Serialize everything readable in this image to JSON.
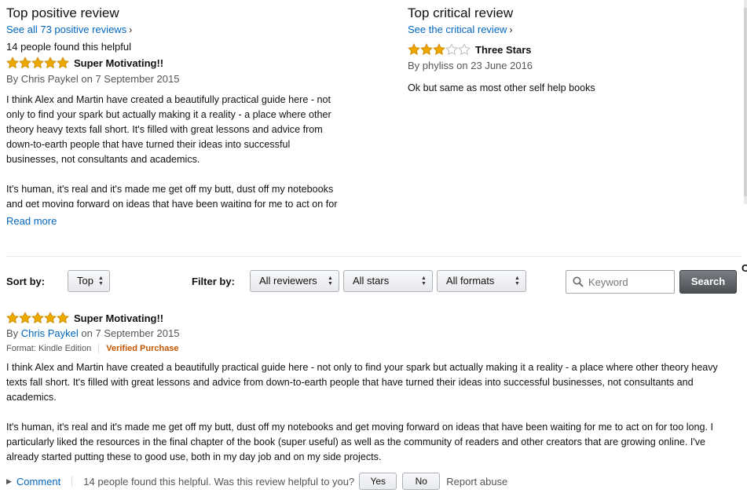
{
  "colors": {
    "link": "#0066c0",
    "star_fill": "#f0a800",
    "verified": "#c45500"
  },
  "top_positive": {
    "heading": "Top positive review",
    "see_all": "See all 73 positive reviews",
    "helpful": "14 people found this helpful",
    "rating": 5,
    "title": "Super Motivating!!",
    "by": "By",
    "author": "Chris Paykel",
    "date": "on 7 September 2015",
    "body_p1": "I think Alex and Martin have created a beautifully practical guide here - not only to find your spark but actually making it a reality - a place where other theory heavy texts fall short. It's filled with great lessons and advice from down-to-earth people that have turned their ideas into successful businesses, not consultants and academics.",
    "body_p2": "It's human, it's real and it's made me get off my butt, dust off my notebooks and get moving forward on ideas that have been waiting for me to act on for too long. I particularly liked the resources in the final",
    "read_more": "Read more"
  },
  "top_critical": {
    "heading": "Top critical review",
    "see_all": "See the critical review",
    "rating": 3,
    "title": "Three Stars",
    "by": "By",
    "author": "phyliss",
    "date": "on 23 June 2016",
    "body": "Ok but same as most other self help books"
  },
  "filter_bar": {
    "sort_label": "Sort by:",
    "sort_value": "Top",
    "filter_label": "Filter by:",
    "reviewers": "All reviewers",
    "stars": "All stars",
    "formats": "All formats",
    "search_placeholder": "Keyword",
    "search_button": "Search",
    "edge_glyph": "C"
  },
  "review": {
    "rating": 5,
    "title": "Super Motivating!!",
    "by": "By",
    "author": "Chris Paykel",
    "date": "on 7 September 2015",
    "format": "Format: Kindle Edition",
    "verified": "Verified Purchase",
    "body_p1": "I think Alex and Martin have created a beautifully practical guide here - not only to find your spark but actually making it a reality - a place where other theory heavy texts fall short. It's filled with great lessons and advice from down-to-earth people that have turned their ideas into successful businesses, not consultants and academics.",
    "body_p2": "It's human, it's real and it's made me get off my butt, dust off my notebooks and get moving forward on ideas that have been waiting for me to act on for too long. I particularly liked the resources in the final chapter of the book (super useful) as well as the community of readers and other creators that are growing online. I've already started putting these to good use, both in my day job and on my side projects.",
    "comment": "Comment",
    "helpful_question": "14 people found this helpful. Was this review helpful to you?",
    "yes": "Yes",
    "no": "No",
    "report": "Report abuse"
  }
}
